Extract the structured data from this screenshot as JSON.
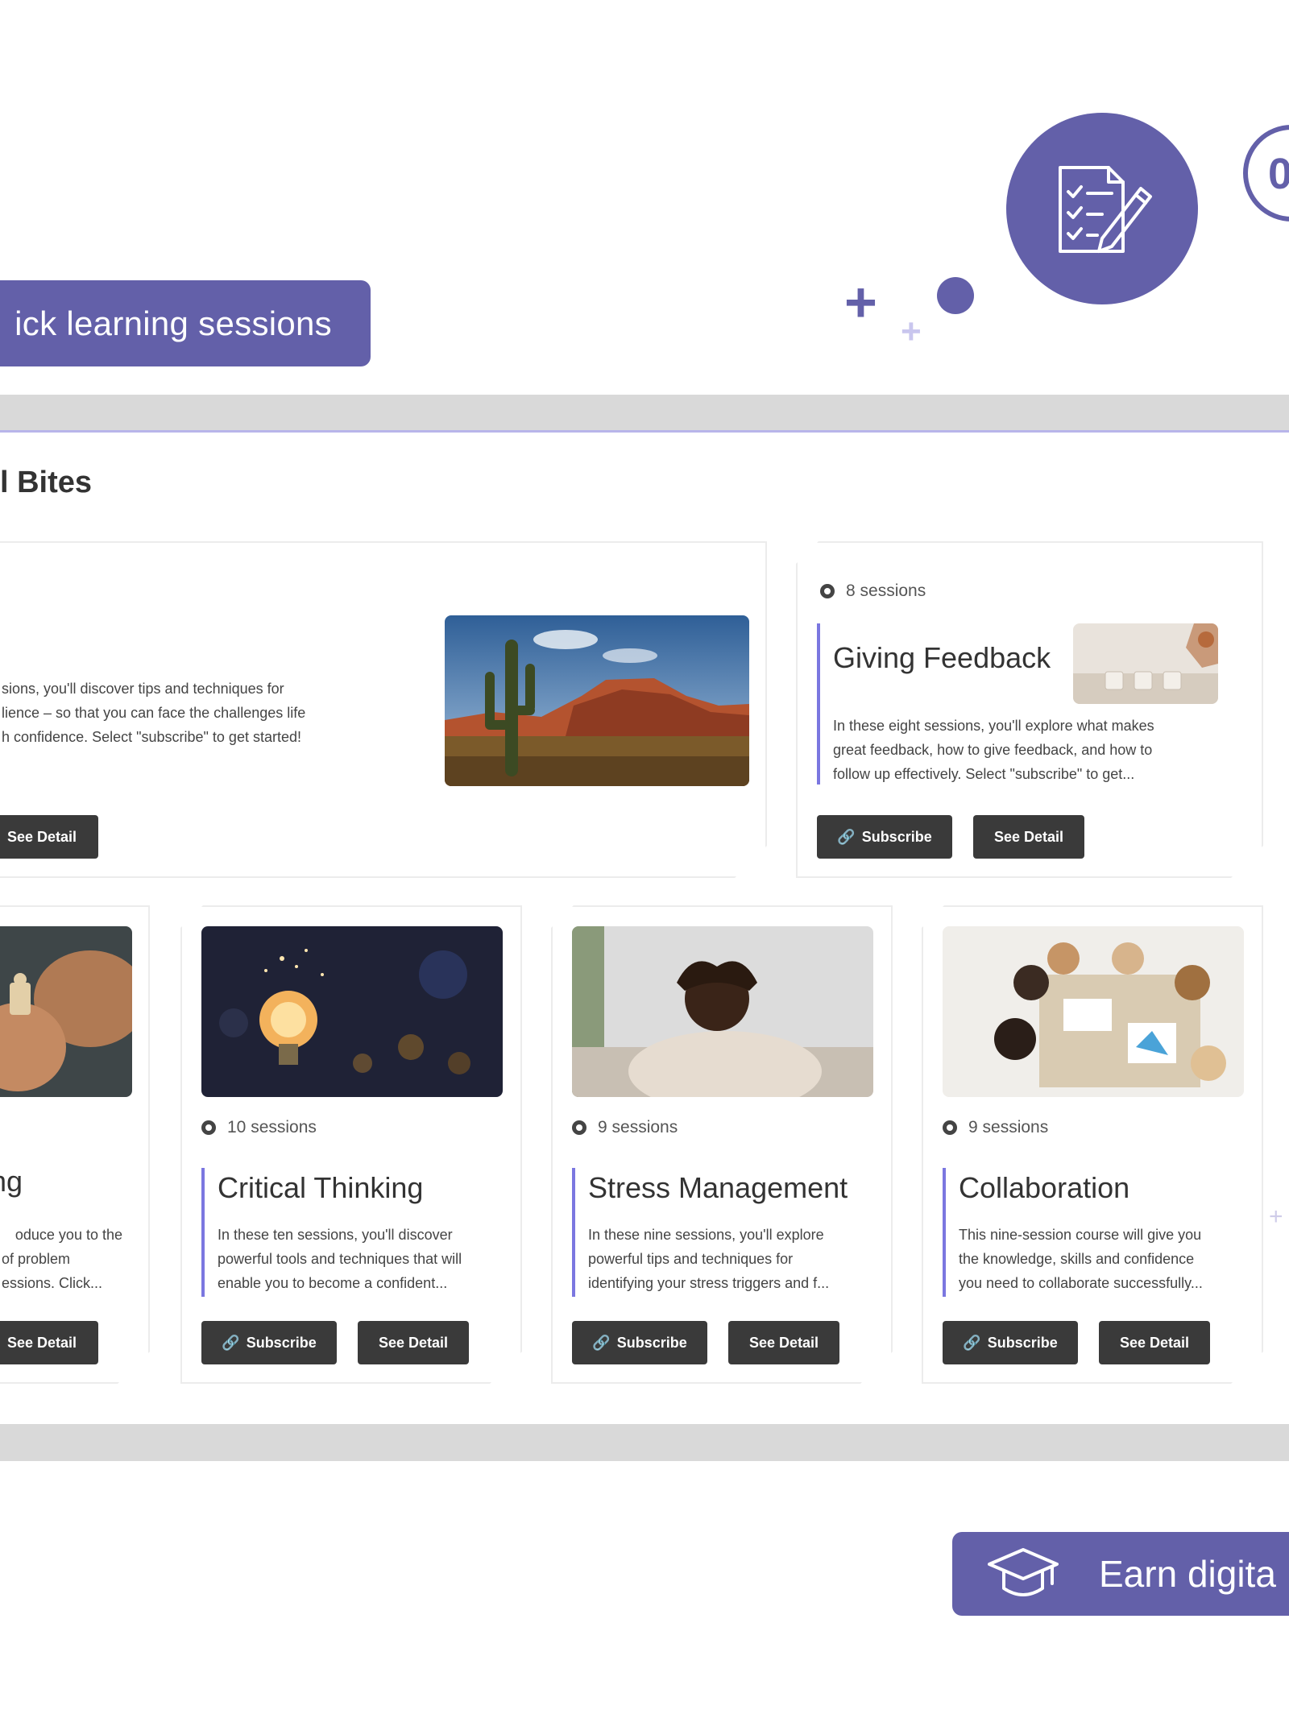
{
  "banner": {
    "pill_label": "ick learning sessions",
    "ring_partial": "0"
  },
  "section": {
    "title": "l Bites"
  },
  "cards": [
    {
      "id": "desert",
      "sessions": "",
      "title": "",
      "desc_lines": [
        "sions, you'll discover tips and techniques for",
        "lience – so that you can face the challenges life",
        "h confidence. Select \"subscribe\" to get started!"
      ],
      "detail_label": "See Detail"
    },
    {
      "id": "giving-feedback",
      "sessions": "8 sessions",
      "title": "Giving Feedback",
      "desc_lines": [
        "In these eight sessions, you'll explore what makes",
        "great feedback, how to give feedback, and how to",
        "follow up effectively. Select \"subscribe\" to get..."
      ],
      "subscribe_label": "Subscribe",
      "detail_label": "See Detail"
    },
    {
      "id": "problem-solving",
      "sessions": "",
      "title": "ving",
      "desc_lines": [
        "oduce you to the",
        "of problem",
        "essions. Click..."
      ],
      "detail_label": "See Detail"
    },
    {
      "id": "critical-thinking",
      "sessions": "10 sessions",
      "title": "Critical Thinking",
      "desc_lines": [
        "In these ten sessions, you'll discover",
        "powerful tools and techniques that will",
        "enable you to become a confident..."
      ],
      "subscribe_label": "Subscribe",
      "detail_label": "See Detail"
    },
    {
      "id": "stress-management",
      "sessions": "9 sessions",
      "title": "Stress Management",
      "desc_lines": [
        "In these nine sessions, you'll explore",
        "powerful tips and techniques for",
        "identifying your stress triggers and f..."
      ],
      "subscribe_label": "Subscribe",
      "detail_label": "See Detail"
    },
    {
      "id": "collaboration",
      "sessions": "9 sessions",
      "title": "Collaboration",
      "desc_lines": [
        "This nine-session course will give you",
        "the knowledge, skills and confidence",
        "you need to collaborate successfully..."
      ],
      "subscribe_label": "Subscribe",
      "detail_label": "See Detail"
    }
  ],
  "footer": {
    "earn_label": "Earn digita"
  },
  "colors": {
    "brand": "#6360a9",
    "accent_bar": "#7b77e0",
    "button_dark": "#3a3a3a",
    "band": "#d9d9d9"
  },
  "icons": [
    "checklist-pen-icon",
    "plus-icon",
    "sessions-icon",
    "link-icon",
    "graduation-cap-icon"
  ]
}
